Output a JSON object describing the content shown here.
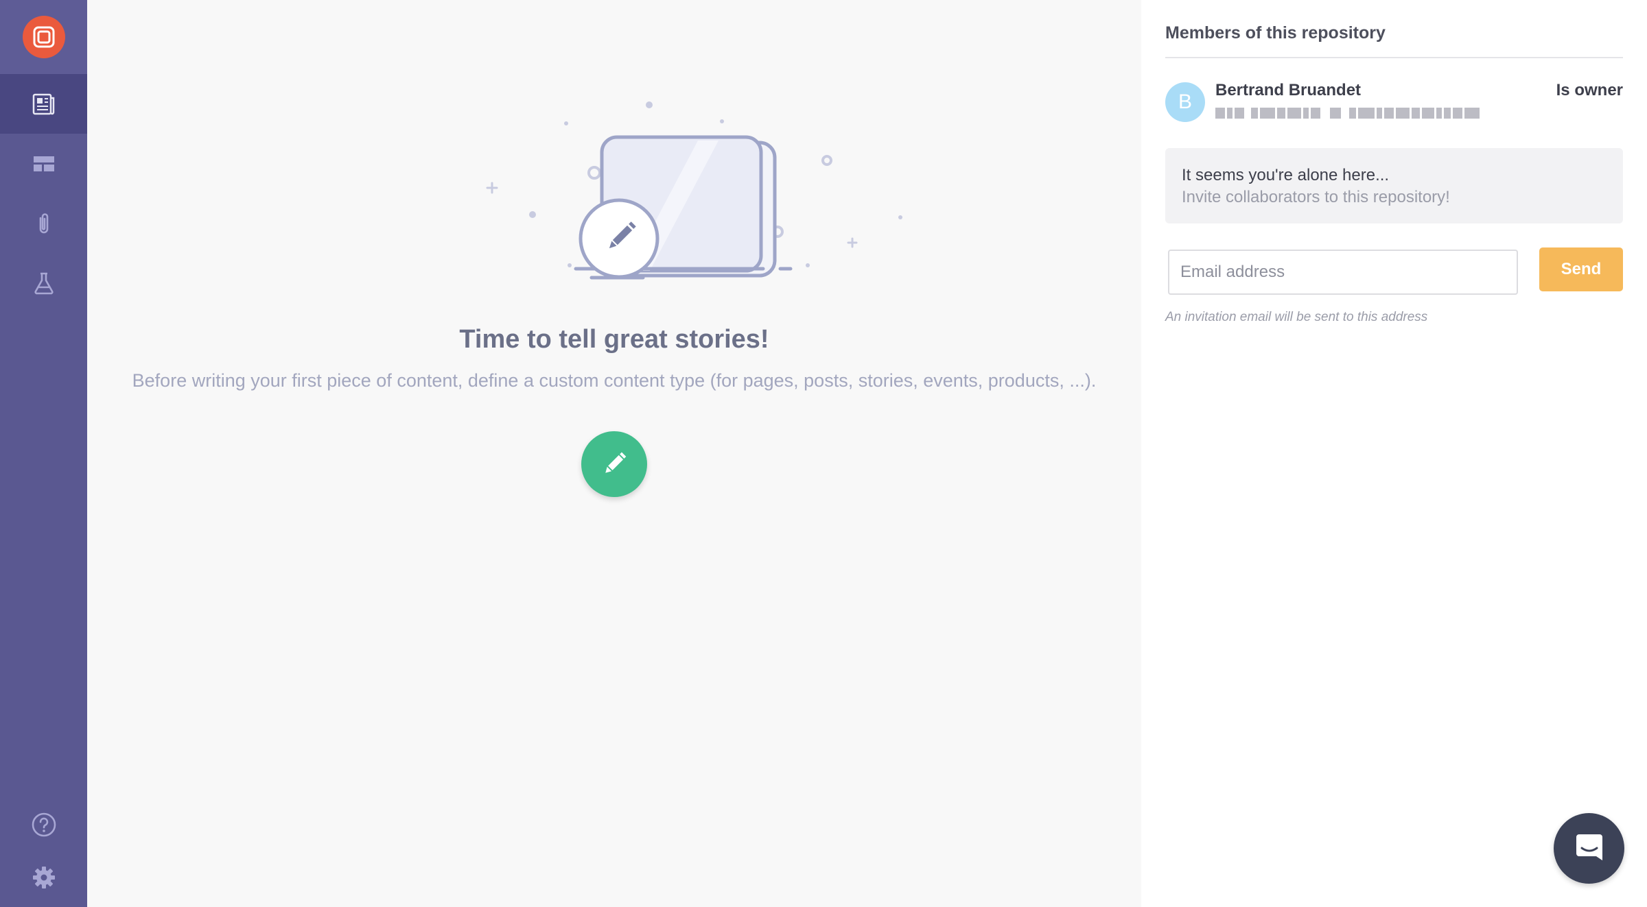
{
  "sidebar": {
    "logo_icon": "prismic-logo-icon",
    "items": [
      {
        "name": "documents",
        "icon": "newspaper-icon",
        "active": true
      },
      {
        "name": "custom-types",
        "icon": "layout-icon",
        "active": false
      },
      {
        "name": "media",
        "icon": "paperclip-icon",
        "active": false
      },
      {
        "name": "experiments",
        "icon": "flask-icon",
        "active": false
      }
    ],
    "bottom_items": [
      {
        "name": "help",
        "icon": "question-circle-icon"
      },
      {
        "name": "settings",
        "icon": "gear-icon"
      }
    ]
  },
  "main": {
    "headline": "Time to tell great stories!",
    "subline": "Before writing your first piece of content, define a custom content type (for pages, posts, stories, events, products, ...).",
    "create_icon": "pencil-icon"
  },
  "panel": {
    "title": "Members of this repository",
    "member": {
      "initial": "B",
      "name": "Bertrand Bruandet",
      "role": "Is owner"
    },
    "alone": {
      "title": "It seems you're alone here...",
      "subtitle": "Invite collaborators to this repository!"
    },
    "invite": {
      "placeholder": "Email address",
      "send_label": "Send",
      "hint": "An invitation email will be sent to this address"
    }
  },
  "chat": {
    "icon": "chat-bubble-icon"
  },
  "colors": {
    "sidebar": "#5a5891",
    "sidebar_active": "#494781",
    "logo": "#ea5a3d",
    "fab": "#41bd8c",
    "send": "#f6b95a",
    "avatar": "#a9dcf7",
    "chat": "#3c4257"
  }
}
